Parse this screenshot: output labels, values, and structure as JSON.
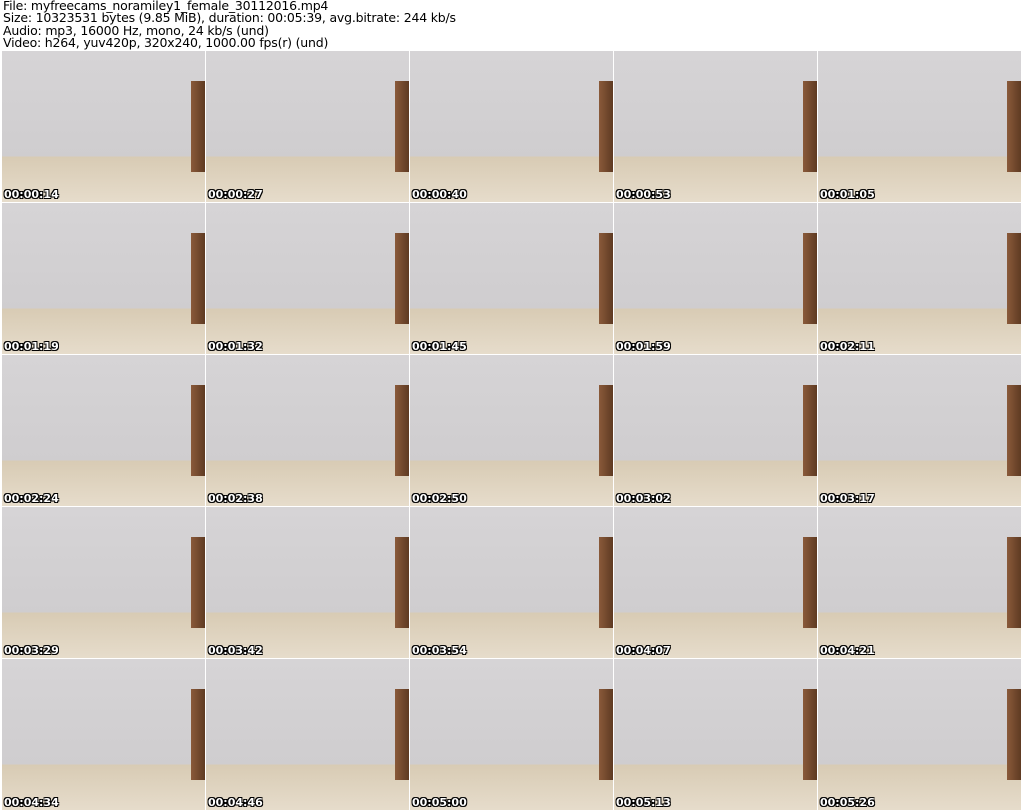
{
  "header": {
    "file": "File: myfreecams_noramiley1_female_30112016.mp4",
    "size": "Size: 10323531 bytes (9.85 MiB), duration: 00:05:39, avg.bitrate: 244 kb/s",
    "audio": "Audio: mp3, 16000 Hz, mono, 24 kb/s (und)",
    "video": "Video: h264, yuv420p, 320x240, 1000.00 fps(r) (und)"
  },
  "thumbnails": [
    "00:00:14",
    "00:00:27",
    "00:00:40",
    "00:00:53",
    "00:01:05",
    "00:01:19",
    "00:01:32",
    "00:01:45",
    "00:01:59",
    "00:02:11",
    "00:02:24",
    "00:02:38",
    "00:02:50",
    "00:03:02",
    "00:03:17",
    "00:03:29",
    "00:03:42",
    "00:03:54",
    "00:04:07",
    "00:04:21",
    "00:04:34",
    "00:04:46",
    "00:05:00",
    "00:05:13",
    "00:05:26"
  ]
}
